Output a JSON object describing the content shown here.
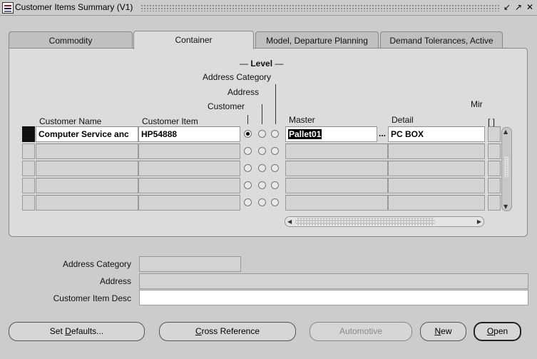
{
  "window": {
    "title": "Customer Items Summary (V1)",
    "controls": [
      "minimize-icon",
      "maximize-icon",
      "close-icon"
    ]
  },
  "tabs": [
    {
      "label": "Commodity",
      "active": false
    },
    {
      "label": "Container",
      "active": true
    },
    {
      "label": "Model, Departure Planning",
      "active": false
    },
    {
      "label": "Demand Tolerances, Active",
      "active": false
    }
  ],
  "level": {
    "title": "Level",
    "address_category": "Address Category",
    "address": "Address",
    "customer": "Customer"
  },
  "columns": {
    "customer_name": "Customer Name",
    "customer_item": "Customer Item",
    "master": "Master",
    "detail": "Detail",
    "min": "Mir",
    "checkbox_hint": "[ ]"
  },
  "rows": [
    {
      "customer_name": "Computer Service anc",
      "customer_item": "HP54888",
      "level": "customer",
      "master": "Pallet01",
      "detail": "PC BOX"
    },
    {
      "customer_name": "",
      "customer_item": "",
      "level": "",
      "master": "",
      "detail": ""
    },
    {
      "customer_name": "",
      "customer_item": "",
      "level": "",
      "master": "",
      "detail": ""
    },
    {
      "customer_name": "",
      "customer_item": "",
      "level": "",
      "master": "",
      "detail": ""
    },
    {
      "customer_name": "",
      "customer_item": "",
      "level": "",
      "master": "",
      "detail": ""
    }
  ],
  "lov_label": "...",
  "detail_fields": {
    "address_category_label": "Address Category",
    "address_label": "Address",
    "customer_item_desc_label": "Customer Item Desc",
    "address_category_value": "",
    "address_value": "",
    "customer_item_desc_value": ""
  },
  "buttons": {
    "set_defaults": {
      "pre": "Set ",
      "u": "D",
      "post": "efaults..."
    },
    "cross_reference": {
      "pre": "",
      "u": "C",
      "post": "ross Reference"
    },
    "automotive": {
      "pre": "Automotive",
      "u": "",
      "post": ""
    },
    "new": {
      "pre": "",
      "u": "N",
      "post": "ew"
    },
    "open": {
      "pre": "",
      "u": "O",
      "post": "pen"
    }
  },
  "colors": {
    "background": "#cccccc",
    "panel": "#dcdcdc",
    "field": "#d3d3d3",
    "active_field": "#ffffff",
    "disabled_text": "#8a8a8a"
  }
}
